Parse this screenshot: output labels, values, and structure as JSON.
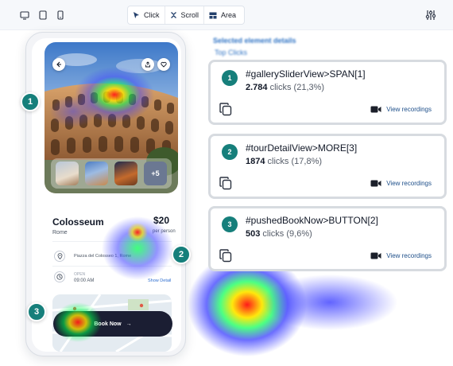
{
  "toolbar": {
    "devices": [
      "desktop-icon",
      "tablet-icon",
      "mobile-icon"
    ],
    "modes": [
      {
        "label": "Click",
        "icon": "cursor-icon"
      },
      {
        "label": "Scroll",
        "icon": "scroll-icon"
      },
      {
        "label": "Area",
        "icon": "area-icon"
      }
    ],
    "settings_icon": "sliders-icon"
  },
  "app": {
    "place_title": "Colosseum",
    "location": "Rome",
    "price": "$20",
    "price_unit": "per person",
    "address": "Piazza del Colosseo 1, Rome",
    "open_label": "OPEN",
    "open_time": "09:00 AM",
    "show_detail": "Show Detail",
    "more_photos": "+5",
    "book_label": "Book Now",
    "book_arrow": "→"
  },
  "markers": [
    "1",
    "2",
    "3"
  ],
  "blurred_heading": {
    "line1": "Selected element details",
    "line2": "Top Clicks"
  },
  "cards": [
    {
      "index": "1",
      "selector": "#gallerySliderView>SPAN[1]",
      "count": "2.784",
      "unit": "clicks",
      "percent": "(21,3%)",
      "action": "View recordings"
    },
    {
      "index": "2",
      "selector": "#tourDetailView>MORE[3]",
      "count": "1874",
      "unit": "clicks",
      "percent": "(17,8%)",
      "action": "View recordings"
    },
    {
      "index": "3",
      "selector": "#pushedBookNow>BUTTON[2]",
      "count": "503",
      "unit": "clicks",
      "percent": "(9,6%)",
      "action": "View recordings"
    }
  ],
  "colors": {
    "accent_teal": "#167f7b",
    "link_blue": "#1e4f8a",
    "button_dark": "#1b1e33",
    "heat_red": "#ff1a1a",
    "heat_yellow": "#ffe600",
    "heat_blue": "#3a3dff"
  }
}
